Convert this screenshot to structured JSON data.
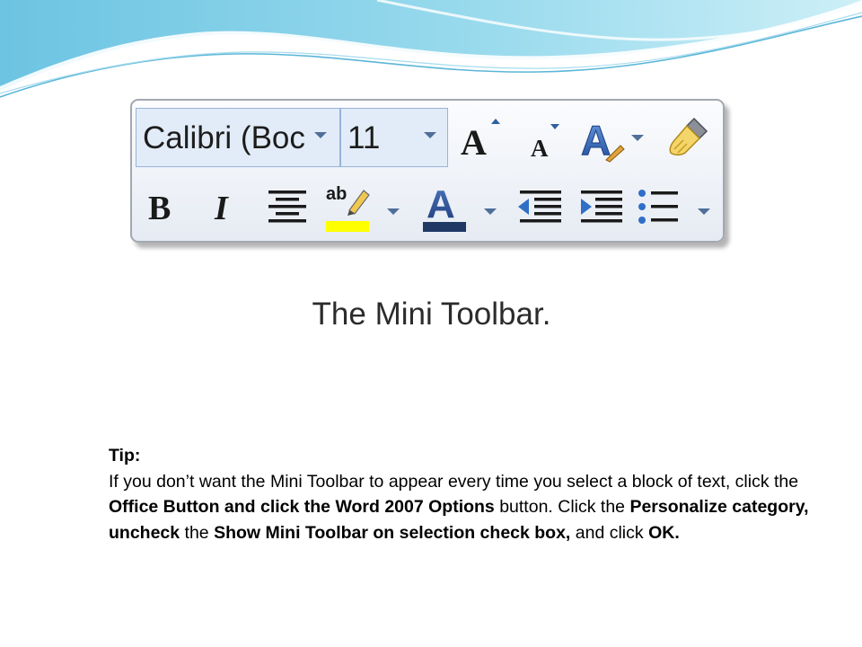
{
  "toolbar": {
    "font_name": "Calibri (Boc",
    "font_size": "11",
    "row1_buttons": [
      "grow-font-icon",
      "shrink-font-icon",
      "styles-icon",
      "format-painter-icon"
    ],
    "row2_buttons": [
      "bold-icon",
      "italic-icon",
      "center-align-icon",
      "highlight-icon",
      "font-color-icon",
      "decrease-indent-icon",
      "increase-indent-icon",
      "bullets-icon"
    ],
    "colors": {
      "highlight": "#ffff00",
      "font_color": "#1f3864",
      "border": "#a3a8b0",
      "combo_bg": "#e2ecf8"
    }
  },
  "caption": "The Mini Toolbar.",
  "tip": {
    "heading": "Tip:",
    "p1": "If you don’t want the Mini Toolbar to appear every time you select a block of text, click the ",
    "b1": "Office Button and click the Word 2007 Options",
    "p2": " button. Click the ",
    "b2": "Personalize category, uncheck",
    "p3": " the ",
    "b3": "Show Mini Toolbar on selection check box,",
    "p4": " and click ",
    "b4": "OK."
  }
}
